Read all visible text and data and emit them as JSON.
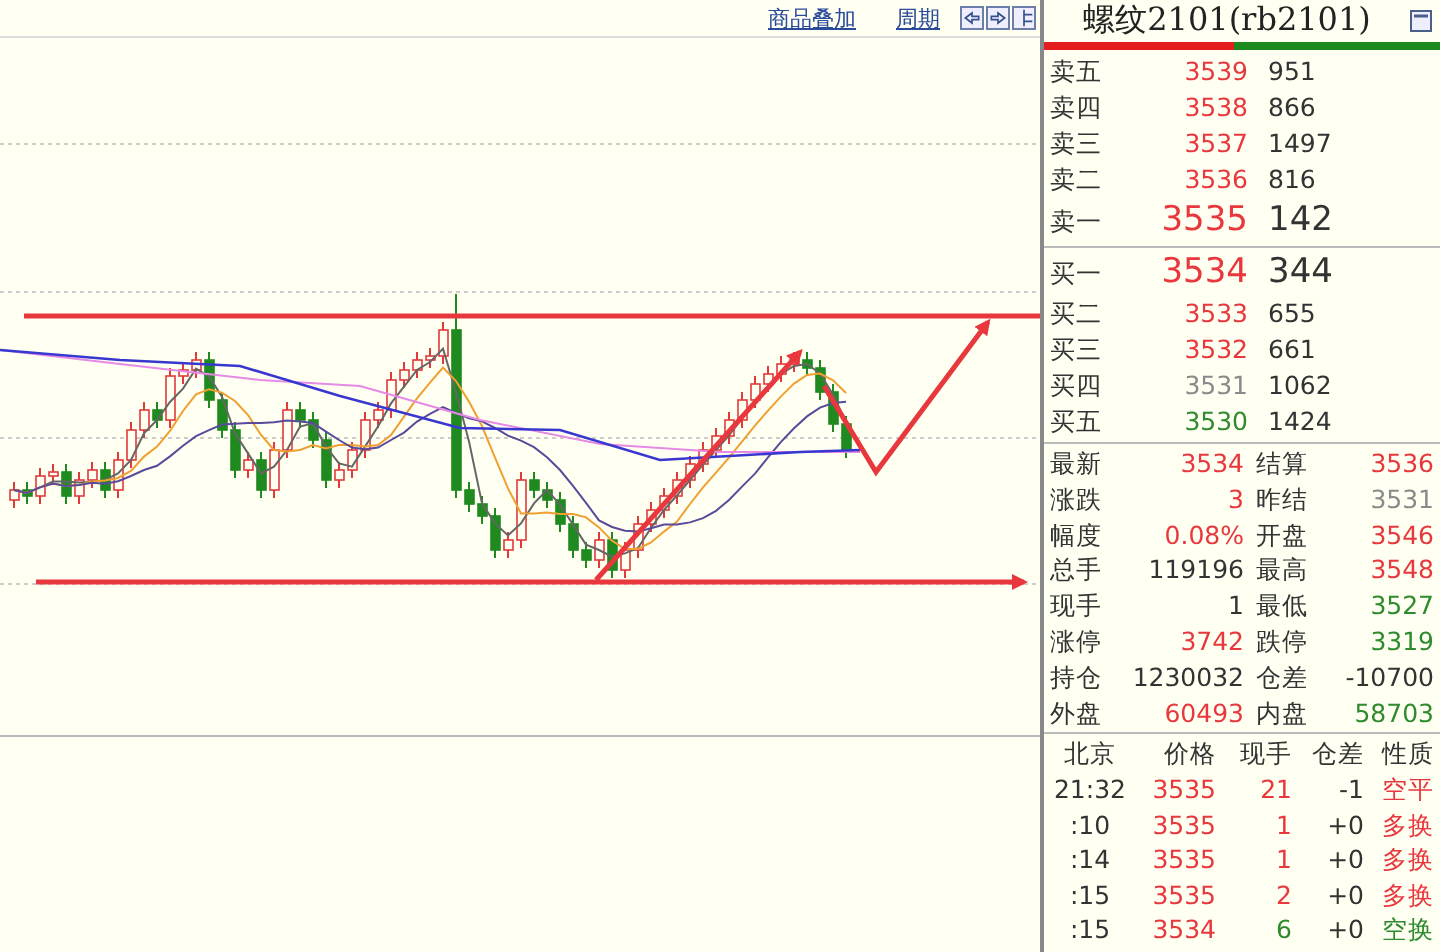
{
  "toolbar": {
    "links": [
      "商品叠加",
      "周期"
    ]
  },
  "quote": {
    "title": "螺纹2101(rb2101)",
    "ratio_bar": {
      "level": 0.48
    },
    "asks": [
      {
        "label": "卖五",
        "price": "3539",
        "volume": "951",
        "color": "#e8383d",
        "best": false
      },
      {
        "label": "卖四",
        "price": "3538",
        "volume": "866",
        "color": "#e8383d",
        "best": false
      },
      {
        "label": "卖三",
        "price": "3537",
        "volume": "1497",
        "color": "#e8383d",
        "best": false
      },
      {
        "label": "卖二",
        "price": "3536",
        "volume": "816",
        "color": "#e8383d",
        "best": false
      },
      {
        "label": "卖一",
        "price": "3535",
        "volume": "142",
        "color": "#e8383d",
        "best": true
      }
    ],
    "bids": [
      {
        "label": "买一",
        "price": "3534",
        "volume": "344",
        "color": "#e8383d",
        "best": true
      },
      {
        "label": "买二",
        "price": "3533",
        "volume": "655",
        "color": "#e8383d",
        "best": false
      },
      {
        "label": "买三",
        "price": "3532",
        "volume": "661",
        "color": "#e8383d",
        "best": false
      },
      {
        "label": "买四",
        "price": "3531",
        "volume": "1062",
        "color": "#8a8a8a",
        "best": false
      },
      {
        "label": "买五",
        "price": "3530",
        "volume": "1424",
        "color": "#2e8b2e",
        "best": false
      }
    ],
    "stats": [
      {
        "label": "最新",
        "value": "3534",
        "color": "#e8383d"
      },
      {
        "label": "结算",
        "value": "3536",
        "color": "#e8383d"
      },
      {
        "label": "涨跌",
        "value": "3",
        "color": "#e8383d"
      },
      {
        "label": "昨结",
        "value": "3531",
        "color": "#8a8a8a"
      },
      {
        "label": "幅度",
        "value": "0.08%",
        "color": "#e8383d"
      },
      {
        "label": "开盘",
        "value": "3546",
        "color": "#e8383d"
      },
      {
        "label": "总手",
        "value": "119196",
        "color": "#333333"
      },
      {
        "label": "最高",
        "value": "3548",
        "color": "#e8383d"
      },
      {
        "label": "现手",
        "value": "1",
        "color": "#333333"
      },
      {
        "label": "最低",
        "value": "3527",
        "color": "#2e8b2e"
      },
      {
        "label": "涨停",
        "value": "3742",
        "color": "#e8383d"
      },
      {
        "label": "跌停",
        "value": "3319",
        "color": "#2e8b2e"
      },
      {
        "label": "持仓",
        "value": "1230032",
        "color": "#333333"
      },
      {
        "label": "仓差",
        "value": "-10700",
        "color": "#333333"
      },
      {
        "label": "外盘",
        "value": "60493",
        "color": "#e8383d"
      },
      {
        "label": "内盘",
        "value": "58703",
        "color": "#2e8b2e"
      }
    ],
    "trades": {
      "columns": [
        "北京",
        "价格",
        "现手",
        "仓差",
        "性质"
      ],
      "rows": [
        {
          "time": "21:32",
          "price": {
            "text": "3535",
            "color": "#e8383d"
          },
          "volume": {
            "text": "21",
            "color": "#e8383d"
          },
          "oi_change": "-1",
          "nature": {
            "text": "空平",
            "color": "#e8383d"
          }
        },
        {
          "time": ":10",
          "price": {
            "text": "3535",
            "color": "#e8383d"
          },
          "volume": {
            "text": "1",
            "color": "#e8383d"
          },
          "oi_change": "+0",
          "nature": {
            "text": "多换",
            "color": "#e8383d"
          }
        },
        {
          "time": ":14",
          "price": {
            "text": "3535",
            "color": "#e8383d"
          },
          "volume": {
            "text": "1",
            "color": "#e8383d"
          },
          "oi_change": "+0",
          "nature": {
            "text": "多换",
            "color": "#e8383d"
          }
        },
        {
          "time": ":15",
          "price": {
            "text": "3535",
            "color": "#e8383d"
          },
          "volume": {
            "text": "2",
            "color": "#e8383d"
          },
          "oi_change": "+0",
          "nature": {
            "text": "多换",
            "color": "#e8383d"
          }
        },
        {
          "time": ":15",
          "price": {
            "text": "3534",
            "color": "#e8383d"
          },
          "volume": {
            "text": "6",
            "color": "#2e8b2e"
          },
          "oi_change": "+0",
          "nature": {
            "text": "空换",
            "color": "#2e8b2e"
          }
        }
      ]
    }
  }
}
